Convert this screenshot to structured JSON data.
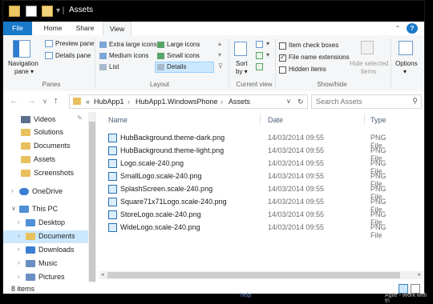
{
  "window": {
    "title": "Assets"
  },
  "tabs": {
    "file": "File",
    "home": "Home",
    "share": "Share",
    "view": "View",
    "help": "?"
  },
  "ribbon": {
    "panes": {
      "navigation_pane": "Navigation",
      "navigation_pane2": "pane",
      "preview_pane": "Preview pane",
      "details_pane": "Details pane",
      "group_label": "Panes"
    },
    "layout": {
      "items": [
        "Extra large icons",
        "Large icons",
        "Medium icons",
        "Small icons",
        "List",
        "Details"
      ],
      "selected": "Details",
      "group_label": "Layout"
    },
    "current_view": {
      "sort_by": "Sort",
      "sort_by2": "by",
      "group_label": "Current view"
    },
    "show_hide": {
      "item_check_boxes": {
        "label": "Item check boxes",
        "checked": false
      },
      "file_name_extensions": {
        "label": "File name extensions",
        "checked": true
      },
      "hidden_items": {
        "label": "Hidden items",
        "checked": false
      },
      "hide_selected": "Hide selected",
      "hide_selected2": "items",
      "group_label": "Show/hide"
    },
    "options": {
      "label": "Options"
    }
  },
  "address": {
    "prefix": "«",
    "crumbs": [
      "HubApp1",
      "HubApp1.WindowsPhone",
      "Assets"
    ],
    "search_placeholder": "Search Assets"
  },
  "tree": [
    {
      "label": "Videos",
      "pinned": true
    },
    {
      "label": "Solutions"
    },
    {
      "label": "Documents"
    },
    {
      "label": "Assets"
    },
    {
      "label": "Screenshots"
    },
    {
      "label": "OneDrive"
    },
    {
      "label": "This PC"
    },
    {
      "label": "Desktop"
    },
    {
      "label": "Documents"
    },
    {
      "label": "Downloads"
    },
    {
      "label": "Music"
    },
    {
      "label": "Pictures"
    }
  ],
  "columns": {
    "name": "Name",
    "date": "Date",
    "type": "Type"
  },
  "files": [
    {
      "name": "HubBackground.theme-dark.png",
      "date": "14/03/2014 09:55",
      "type": "PNG File"
    },
    {
      "name": "HubBackground.theme-light.png",
      "date": "14/03/2014 09:55",
      "type": "PNG File"
    },
    {
      "name": "Logo.scale-240.png",
      "date": "14/03/2014 09:55",
      "type": "PNG File"
    },
    {
      "name": "SmallLogo.scale-240.png",
      "date": "14/03/2014 09:55",
      "type": "PNG File"
    },
    {
      "name": "SplashScreen.scale-240.png",
      "date": "14/03/2014 09:55",
      "type": "PNG File"
    },
    {
      "name": "Square71x71Logo.scale-240.png",
      "date": "14/03/2014 09:55",
      "type": "PNG File"
    },
    {
      "name": "StoreLogo.scale-240.png",
      "date": "14/03/2014 09:55",
      "type": "PNG File"
    },
    {
      "name": "WideLogo.scale-240.png",
      "date": "14/03/2014 09:55",
      "type": "PNG File"
    }
  ],
  "status": {
    "item_count": "8 items"
  },
  "background_text": {
    "left": "help",
    "right": "Agile - Work with th"
  },
  "colors": {
    "accent": "#1979ca",
    "folder": "#e8c15e",
    "selection": "#cce8ff"
  }
}
